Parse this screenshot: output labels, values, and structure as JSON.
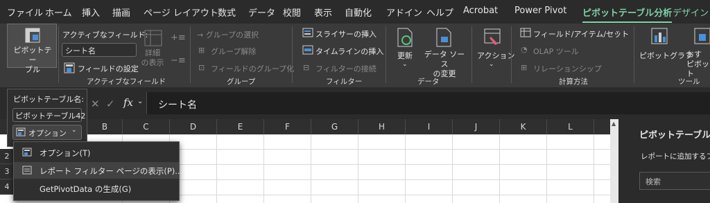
{
  "menu": {
    "tabs": [
      "ファイル",
      "ホーム",
      "挿入",
      "描画",
      "ページ レイアウト",
      "数式",
      "データ",
      "校閲",
      "表示",
      "自動化",
      "アドイン",
      "ヘルプ",
      "Acrobat",
      "Power Pivot",
      "ピボットテーブル分析",
      "デザイン"
    ]
  },
  "ribbon": {
    "pivot_table_button": "ピボットテー\nブル",
    "active_field": {
      "label": "アクティブなフィールド:",
      "value": "シート名",
      "details": "詳細\nの表示",
      "field_settings": "フィールドの設定",
      "group_label": "アクティブなフィールド"
    },
    "group": {
      "select": "→ グループの選択",
      "ungroup": "グループ解除",
      "field_group": "フィールドのグループ化",
      "group_label": "グループ"
    },
    "filter": {
      "slicer": "スライサーの挿入",
      "timeline": "タイムラインの挿入",
      "connections": "フィルターの接続",
      "group_label": "フィルター"
    },
    "data": {
      "refresh": "更新",
      "change_source": "データ ソース\nの変更",
      "group_label": "データ"
    },
    "actions": {
      "label": "アクション"
    },
    "calc": {
      "fields_items": "フィールド/アイテム/セット",
      "olap": "OLAP ツール",
      "relationships": "リレーションシップ",
      "group_label": "計算方法"
    },
    "tools": {
      "pivot_chart": "ピボットグラフ",
      "recommended": "おす\nピボット",
      "group_label": "ツール"
    }
  },
  "formula_bar": {
    "fx": "fx",
    "content": "シート名"
  },
  "pivot_popup": {
    "name_label": "ピボットテーブル名:",
    "name_value": "ピボットテーブル42",
    "options_button": "オプション"
  },
  "dropdown": {
    "items": [
      "オプション(T)",
      "レポート フィルター ページの表示(P)...",
      "GetPivotData の生成(G)"
    ]
  },
  "sheet": {
    "columns": [
      "B",
      "C",
      "D",
      "E",
      "F",
      "G",
      "H",
      "I",
      "J",
      "K",
      "L",
      "M"
    ],
    "rows": [
      "2",
      "3",
      "4"
    ]
  },
  "side_pane": {
    "title": "ピボットテーブルの",
    "subtitle": "レポートに追加するフィ",
    "search_placeholder": "検索"
  },
  "colors": {
    "accent": "#7fd3a6",
    "ribbon_bg": "#3a3a3a",
    "menubar_bg": "#2b2b2b"
  }
}
